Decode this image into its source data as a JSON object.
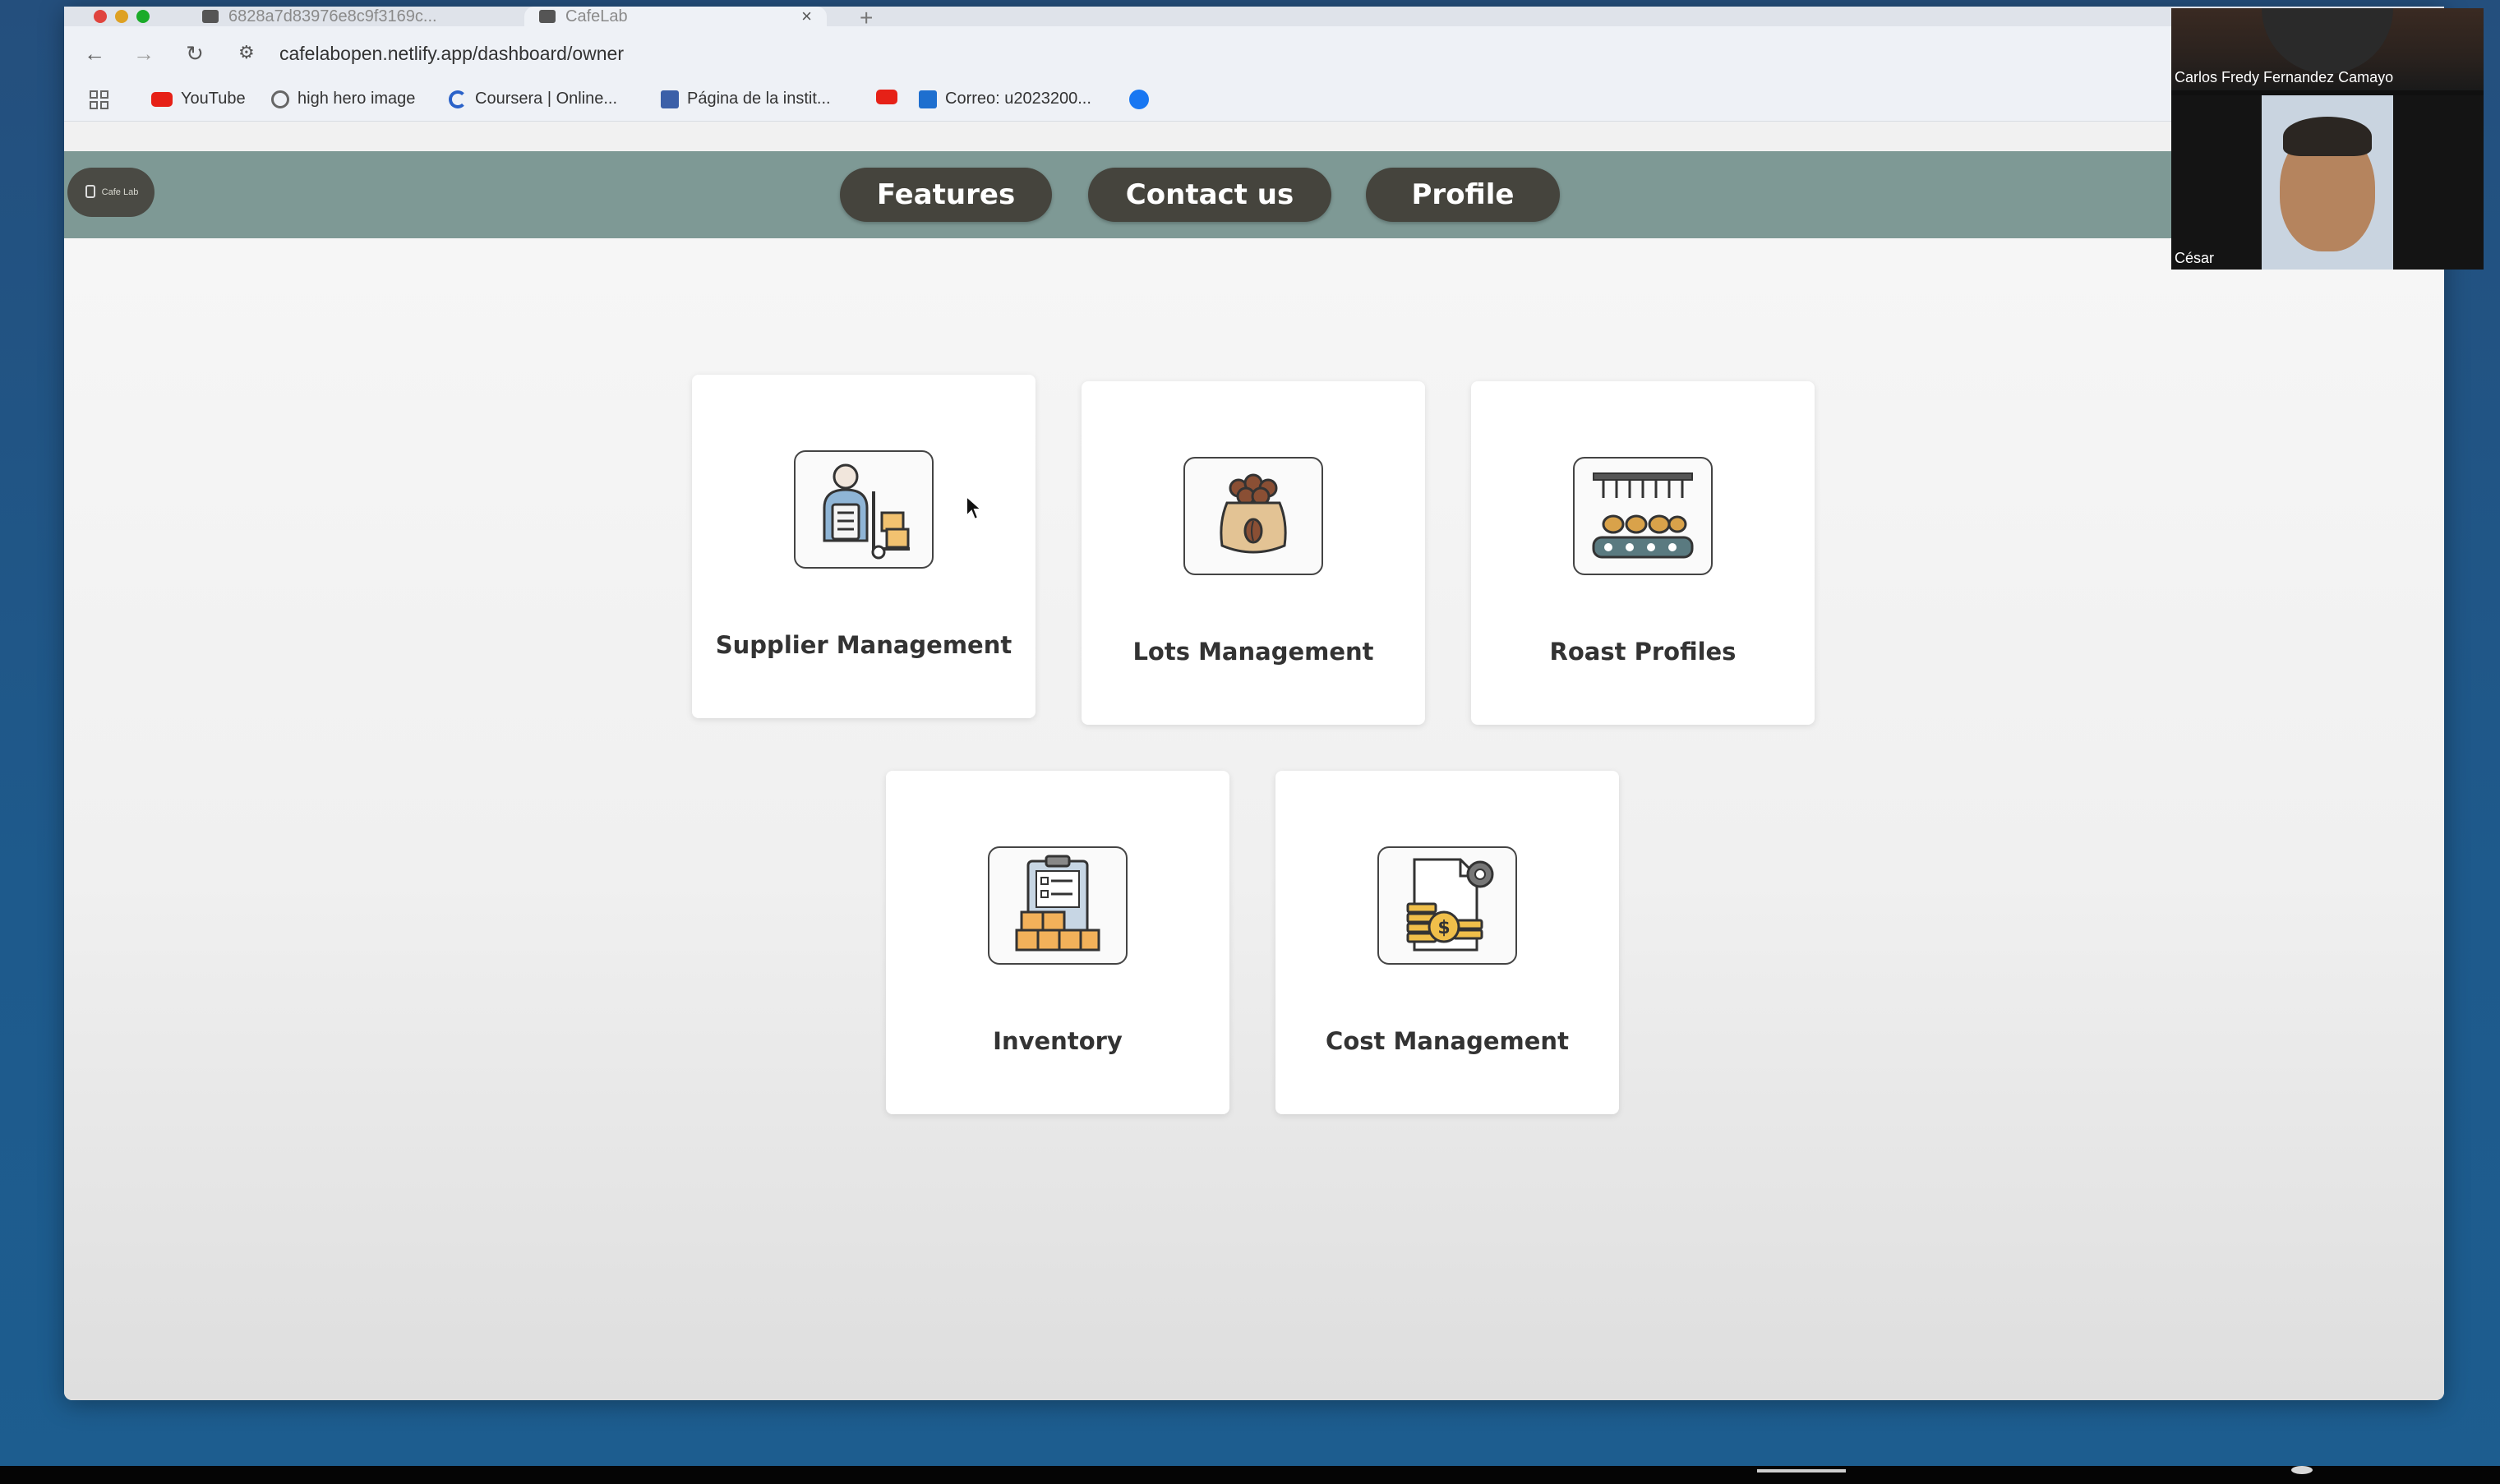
{
  "browser": {
    "tabs": [
      {
        "label": "6828a7d83976e8c9f3169c..."
      },
      {
        "label": "CafeLab"
      }
    ],
    "url": "cafelabopen.netlify.app/dashboard/owner",
    "bookmarks": [
      {
        "label": "YouTube",
        "icon": "youtube-icon"
      },
      {
        "label": "high hero image",
        "icon": "globe-icon"
      },
      {
        "label": "Coursera | Online...",
        "icon": "coursera-icon"
      },
      {
        "label": "Página de la instit...",
        "icon": "institution-icon"
      },
      {
        "label": "",
        "icon": "youtube-icon"
      },
      {
        "label": "Correo: u2023200...",
        "icon": "outlook-icon"
      },
      {
        "label": "",
        "icon": "facebook-icon"
      }
    ]
  },
  "header": {
    "logo_text": "Cafe Lab",
    "nav": [
      {
        "label": "Features"
      },
      {
        "label": "Contact us"
      },
      {
        "label": "Profile"
      }
    ]
  },
  "dashboard": {
    "cards": [
      {
        "label": "Supplier Management",
        "icon": "supplier-icon"
      },
      {
        "label": "Lots Management",
        "icon": "coffee-sack-icon"
      },
      {
        "label": "Roast Profiles",
        "icon": "roaster-icon"
      },
      {
        "label": "Inventory",
        "icon": "clipboard-boxes-icon"
      },
      {
        "label": "Cost Management",
        "icon": "cost-document-icon"
      }
    ]
  },
  "video_call": {
    "participants": [
      {
        "name": "Carlos Fredy Fernandez Camayo"
      },
      {
        "name": "César"
      }
    ]
  },
  "colors": {
    "header_bg": "#7e9995",
    "nav_button_bg": "#45443d",
    "desktop_bg": "#1f5486"
  }
}
